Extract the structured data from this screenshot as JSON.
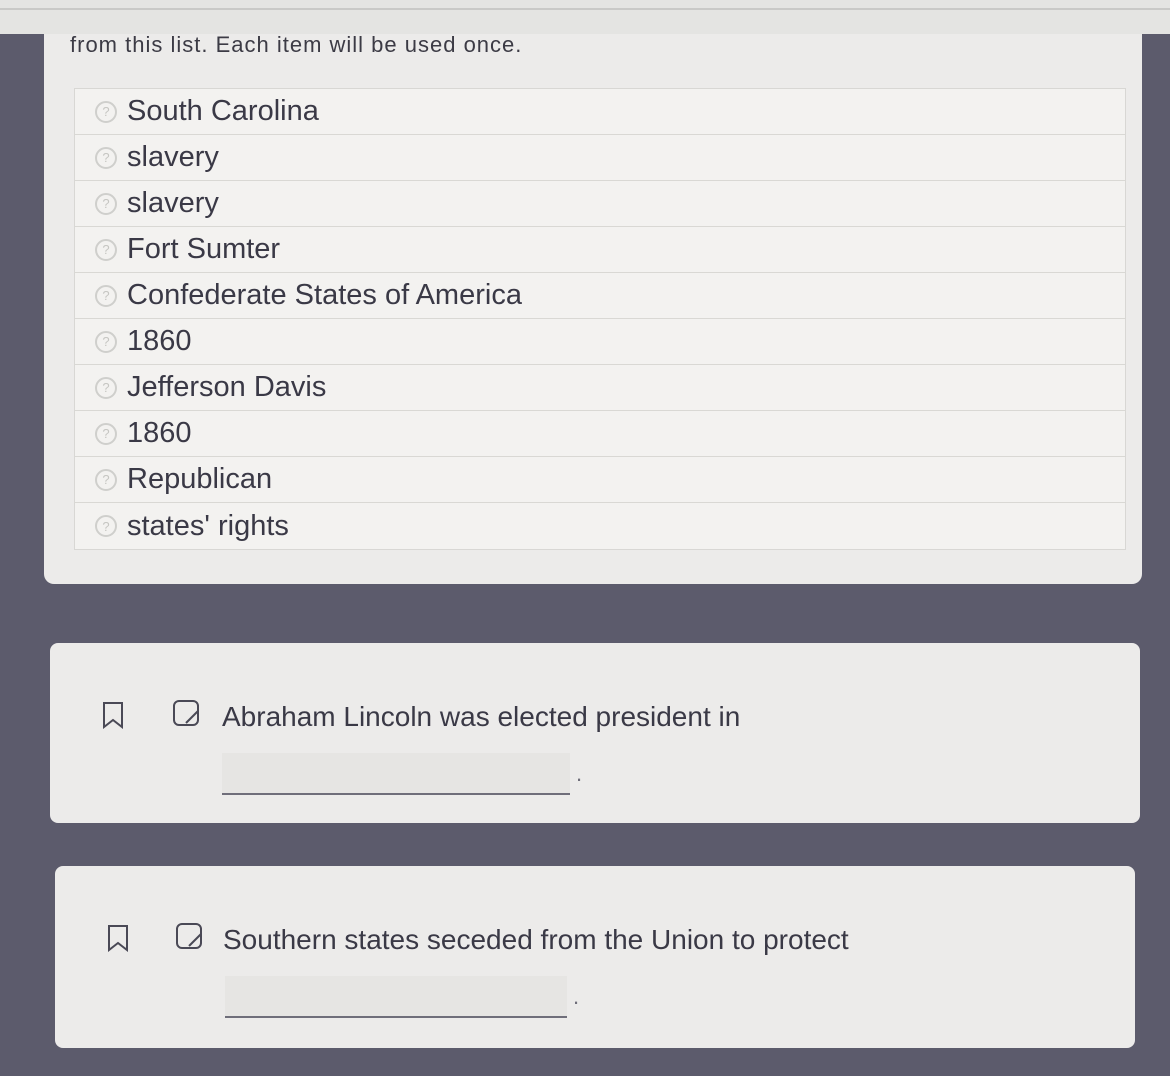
{
  "instructions": "from this list. Each item will be used once.",
  "word_bank": [
    {
      "label": "South Carolina"
    },
    {
      "label": "slavery"
    },
    {
      "label": "slavery"
    },
    {
      "label": "Fort Sumter"
    },
    {
      "label": "Confederate States of America"
    },
    {
      "label": "1860"
    },
    {
      "label": "Jefferson Davis"
    },
    {
      "label": "1860"
    },
    {
      "label": "Republican"
    },
    {
      "label": "states' rights"
    }
  ],
  "word_bank_icon": "question-circle-icon",
  "questions": [
    {
      "text": "Abraham Lincoln was elected president in",
      "answer": "",
      "suffix": "."
    },
    {
      "text": "Southern states seceded from the Union to protect",
      "answer": "",
      "suffix": "."
    }
  ],
  "colors": {
    "background": "#5c5b6c",
    "card": "#ecebea",
    "text": "#3a3946"
  }
}
